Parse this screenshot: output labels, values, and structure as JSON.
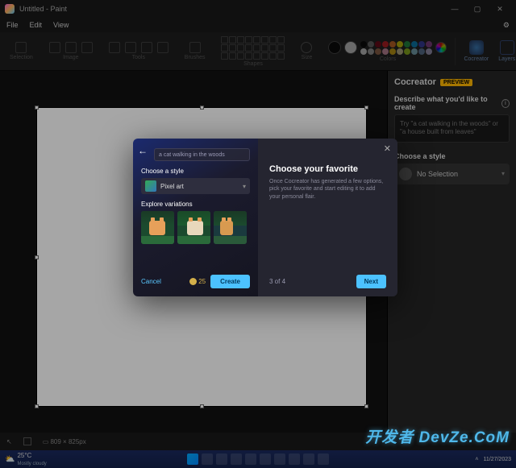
{
  "titlebar": {
    "title": "Untitled - Paint"
  },
  "menu": {
    "file": "File",
    "edit": "Edit",
    "view": "View"
  },
  "ribbon": {
    "groups": {
      "selection": "Selection",
      "image": "Image",
      "tools": "Tools",
      "brushes": "Brushes",
      "shapes": "Shapes",
      "size": "Size",
      "colors": "Colors"
    },
    "cocreator": "Cocreator",
    "layers": "Layers"
  },
  "sidepanel": {
    "title": "Cocreator",
    "badge": "PREVIEW",
    "describe_label": "Describe what you'd like to create",
    "placeholder": "Try \"a cat walking in the woods\" or \"a house built from leaves\"",
    "style_label": "Choose a style",
    "style_value": "No Selection"
  },
  "dialog": {
    "prompt_value": "a cat walking in the woods",
    "style_label": "Choose a style",
    "style_value": "Pixel art",
    "explore_label": "Explore variations",
    "cancel": "Cancel",
    "credits": "25",
    "create": "Create",
    "favorite_title": "Choose your favorite",
    "favorite_body": "Once Cocreator has generated a few options, pick your favorite and start editing it to add your personal flair.",
    "step": "3 of 4",
    "next": "Next"
  },
  "statusbar": {
    "dims": "809 × 825px"
  },
  "taskbar": {
    "temp": "25°C",
    "cond": "Mostly cloudy",
    "date": "11/27/2023"
  },
  "watermark": "开发者 DevZe.CoM",
  "palette_colors": [
    "#000",
    "#7f7f7f",
    "#880015",
    "#ed1c24",
    "#ff7f27",
    "#fff200",
    "#22b14c",
    "#00a2e8",
    "#3f48cc",
    "#a349a4",
    "#fff",
    "#c3c3c3",
    "#b97a57",
    "#ffaec9",
    "#ffc90e",
    "#efe4b0",
    "#b5e61d",
    "#99d9ea",
    "#7092be",
    "#c8bfe7"
  ]
}
